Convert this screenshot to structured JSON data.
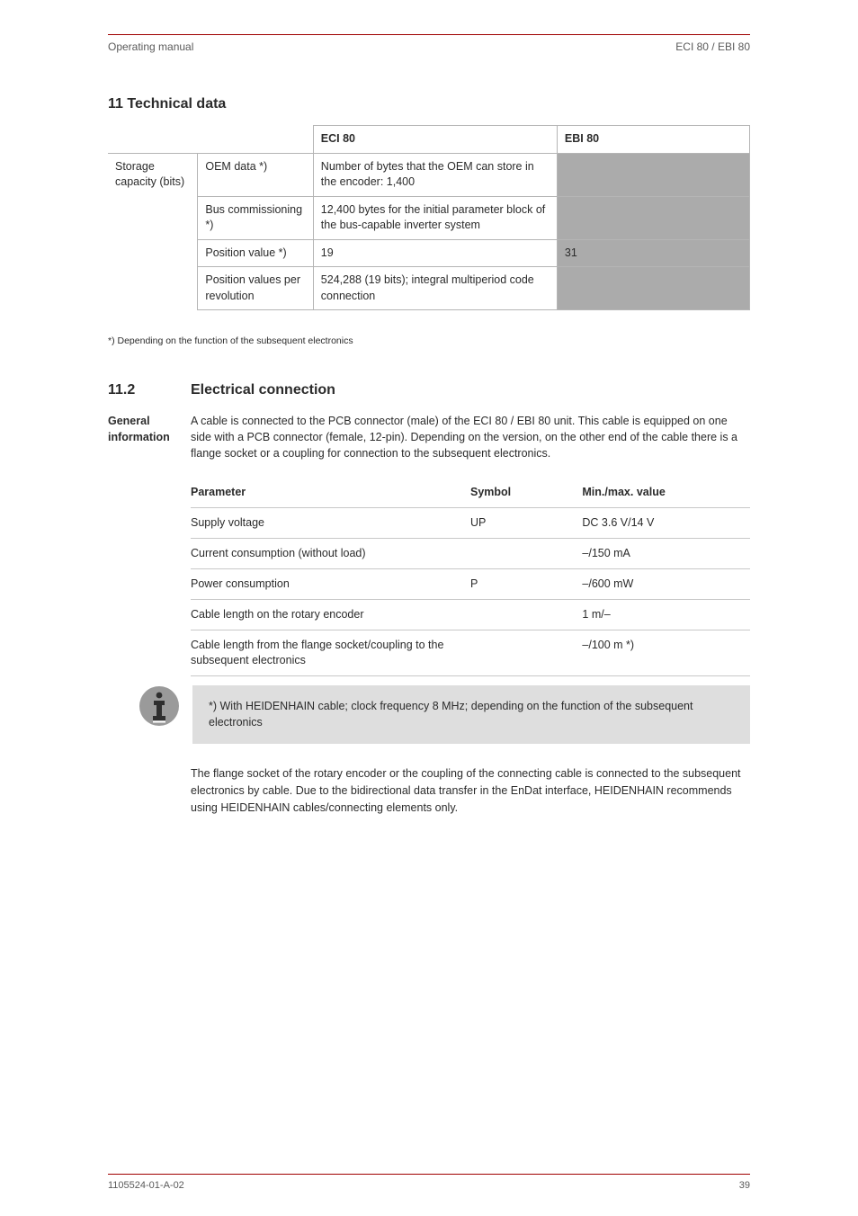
{
  "header": {
    "left": "Operating manual",
    "right": "ECI 80 / EBI 80"
  },
  "section_title": "11 Technical data",
  "table1": {
    "head": [
      "",
      "",
      "ECI 80",
      "EBI 80"
    ],
    "row_label": "Storage capacity (bits)",
    "rows": [
      [
        "OEM data *)",
        "Number of bytes that the OEM can store in the encoder: 1,400",
        ""
      ],
      [
        "Bus commissioning *)",
        "12,400 bytes for the initial parameter block of the bus-capable inverter system",
        ""
      ],
      [
        "Position value *)",
        "19",
        "31"
      ],
      [
        "Position values per revolution",
        "524,288 (19 bits); integral multiperiod code connection",
        ""
      ]
    ]
  },
  "note_small": "*) Depending on the function of the subsequent electronics",
  "subsection": {
    "number": "11.2",
    "title": "Electrical connection"
  },
  "para": {
    "label": "General information",
    "text": "A cable is connected to the PCB connector (male) of the ECI 80 / EBI 80 unit. This cable is equipped on one side with a PCB connector (female, 12-pin). Depending on the version, on the other end of the cable there is a flange socket or a coupling for connection to the subsequent electronics."
  },
  "table2": {
    "head": [
      "Parameter",
      "Symbol",
      "Min./max. value"
    ],
    "rows": [
      [
        "Supply voltage",
        "UP",
        "DC 3.6 V/14 V"
      ],
      [
        "Current consumption (without load)",
        "",
        "–/150 mA"
      ],
      [
        "Power consumption",
        "P",
        "–/600 mW"
      ],
      [
        "Cable length on the rotary encoder",
        "",
        "1 m/–"
      ],
      [
        "Cable length from the flange socket/coupling to the subsequent electronics",
        "",
        "–/100 m *)"
      ]
    ]
  },
  "info": {
    "text": "*) With HEIDENHAIN cable; clock frequency 8 MHz; depending on the function of the subsequent electronics"
  },
  "after": "The flange socket of the rotary encoder or the coupling of the connecting cable is connected to the subsequent electronics by cable. Due to the bidirectional data transfer in the EnDat interface, HEIDENHAIN recommends using HEIDENHAIN cables/connecting elements only.",
  "footer": {
    "left": "1105524-01-A-02",
    "right": "39"
  }
}
